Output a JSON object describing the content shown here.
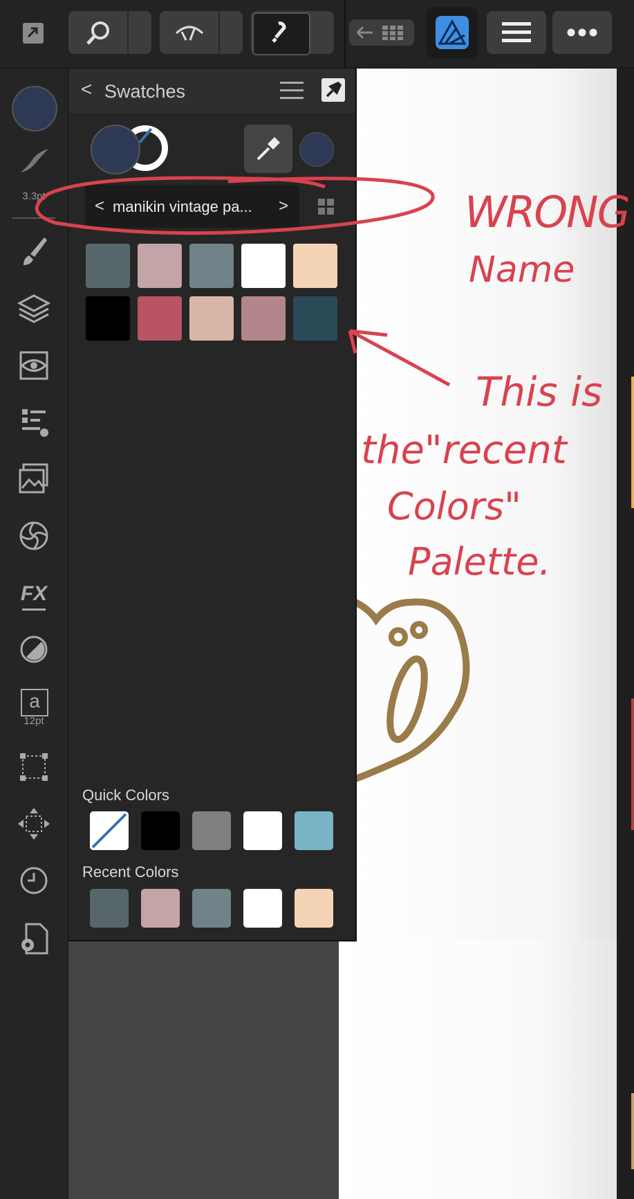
{
  "toolbar": {
    "icons": [
      "fullscreen-icon",
      "zoom-icon",
      "view-mode-icon",
      "snapping-magnet-icon",
      "undo-grid-icon",
      "affinity-app-icon",
      "hamburger-menu-icon",
      "more-icon"
    ]
  },
  "tools": {
    "brush_size": "3.3pt",
    "text_size": "12pt",
    "text_glyph": "a",
    "fx_label": "FX"
  },
  "panel": {
    "back_glyph": "<",
    "title": "Swatches",
    "palette_prev": "<",
    "palette_next": ">",
    "palette_name": "manikin vintage pa...",
    "palette_swatches": [
      "#57666a",
      "#c4a4a6",
      "#6f8388",
      "#ffffff",
      "#f5d4b5",
      "#000000",
      "#b95465",
      "#d9b5a8",
      "#b2868a",
      "#2b4a58"
    ],
    "primary_color": "#2e3a55",
    "quick_colors_label": "Quick Colors",
    "quick_colors": [
      "none",
      "#000000",
      "#808080",
      "#ffffff",
      "#79b5c6"
    ],
    "recent_colors_label": "Recent Colors",
    "recent_colors": [
      "#57666a",
      "#c4a4a6",
      "#6f8388",
      "#ffffff",
      "#f5d4b5"
    ]
  },
  "annotations": {
    "wrong": "WRONG",
    "name": "Name",
    "line1": "This is",
    "line2": "the\"recent",
    "line3": "Colors\"",
    "line4": "Palette."
  }
}
